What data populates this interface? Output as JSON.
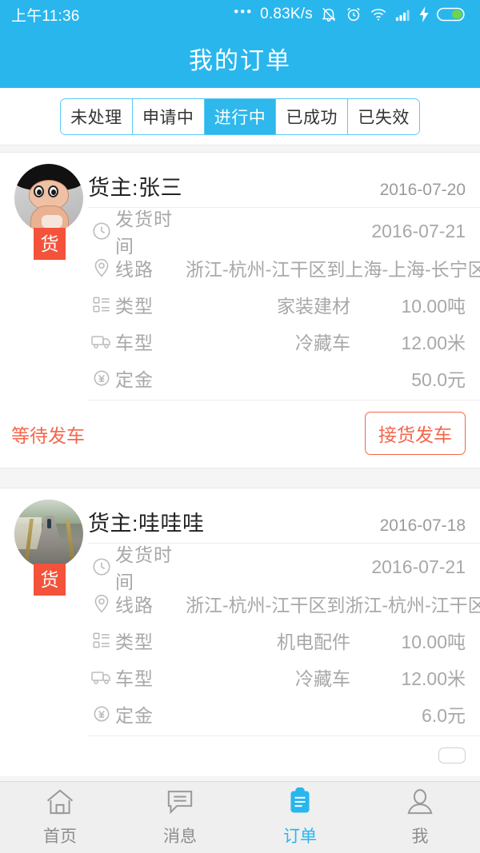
{
  "statusbar": {
    "time": "上午11:36",
    "dots": "•••",
    "net_speed": "0.83K/s",
    "icons": [
      "mute-bell-icon",
      "alarm-clock-icon",
      "wifi-icon",
      "signal-bars-icon",
      "charging-bolt-icon",
      "battery-icon"
    ]
  },
  "header": {
    "title": "我的订单"
  },
  "tabs": [
    {
      "label": "未处理",
      "active": false
    },
    {
      "label": "申请中",
      "active": false
    },
    {
      "label": "进行中",
      "active": true
    },
    {
      "label": "已成功",
      "active": false
    },
    {
      "label": "已失效",
      "active": false
    }
  ],
  "orders": [
    {
      "owner": "货主:张三",
      "date": "2016-07-20",
      "badge": "货",
      "avatar": "cartoon-avatar",
      "details": [
        {
          "icon": "clock-icon",
          "label": "发货时间",
          "value": "2016-07-21",
          "value2": ""
        },
        {
          "icon": "location-pin-icon",
          "label": "线路",
          "value": "浙江-杭州-江干区到上海-上海-长宁区",
          "value2": ""
        },
        {
          "icon": "list-icon",
          "label": "类型",
          "value": "家装建材",
          "value2": "10.00吨"
        },
        {
          "icon": "truck-icon",
          "label": "车型",
          "value": "冷藏车",
          "value2": "12.00米"
        },
        {
          "icon": "yen-circle-icon",
          "label": "定金",
          "value": "",
          "value2": "50.0元"
        }
      ],
      "status": "等待发车",
      "action": "接货发车"
    },
    {
      "owner": "货主:哇哇哇",
      "date": "2016-07-18",
      "badge": "货",
      "avatar": "bridge-photo-avatar",
      "details": [
        {
          "icon": "clock-icon",
          "label": "发货时间",
          "value": "2016-07-21",
          "value2": ""
        },
        {
          "icon": "location-pin-icon",
          "label": "线路",
          "value": "浙江-杭州-江干区到浙江-杭州-江干区",
          "value2": ""
        },
        {
          "icon": "list-icon",
          "label": "类型",
          "value": "机电配件",
          "value2": "10.00吨"
        },
        {
          "icon": "truck-icon",
          "label": "车型",
          "value": "冷藏车",
          "value2": "12.00米"
        },
        {
          "icon": "yen-circle-icon",
          "label": "定金",
          "value": "",
          "value2": "6.0元"
        }
      ],
      "status": "",
      "action": ""
    }
  ],
  "bottomnav": [
    {
      "label": "首页",
      "icon": "home-icon",
      "active": false
    },
    {
      "label": "消息",
      "icon": "message-icon",
      "active": false
    },
    {
      "label": "订单",
      "icon": "clipboard-icon",
      "active": true
    },
    {
      "label": "我",
      "icon": "person-icon",
      "active": false
    }
  ],
  "colors": {
    "brand_blue": "#29b6ed",
    "tab_active_blue": "#2eb8ec",
    "accent_orange": "#f4664a",
    "badge_red": "#f4523b",
    "muted_gray": "#a8a8a8"
  }
}
